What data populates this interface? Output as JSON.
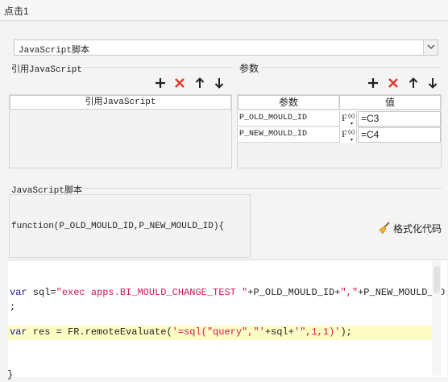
{
  "title": "点击1",
  "script_type_select": {
    "value": "JavaScript脚本"
  },
  "ref_section": {
    "label": "引用JavaScript",
    "column_header": "引用JavaScript"
  },
  "params_section": {
    "label": "参数",
    "headers": {
      "name": "参数",
      "value": "值"
    },
    "rows": [
      {
        "name": "P_OLD_MOULD_ID",
        "value": "=C3"
      },
      {
        "name": "P_NEW_MOULD_ID",
        "value": "=C4"
      }
    ]
  },
  "js_section": {
    "label": "JavaScript脚本",
    "function_signature": "function(P_OLD_MOULD_ID,P_NEW_MOULD_ID){",
    "format_button": "格式化代码",
    "code": {
      "line1_kw": "var",
      "line1_a": " sql=",
      "line1_str": "\"exec apps.BI_MOULD_CHANGE_TEST \"",
      "line1_b": "+P_OLD_MOULD_ID+",
      "line1_str2": "\",\"",
      "line1_c": "+P_NEW_MOULD_ID",
      "line2": ";",
      "line3_kw": "var",
      "line3_a": " res = FR.remoteEvaluate(",
      "line3_str": "'=sql(\"query\",\"'",
      "line3_b": "+sql+",
      "line3_str2": "'\",1,1)'",
      "line3_c": ");"
    },
    "closing_brace": "}"
  },
  "colors": {
    "delete": "#e0352b",
    "accent_code_keyword": "#1a1aa6",
    "accent_code_string": "#d4145a",
    "highlight": "#fdfdc3"
  }
}
